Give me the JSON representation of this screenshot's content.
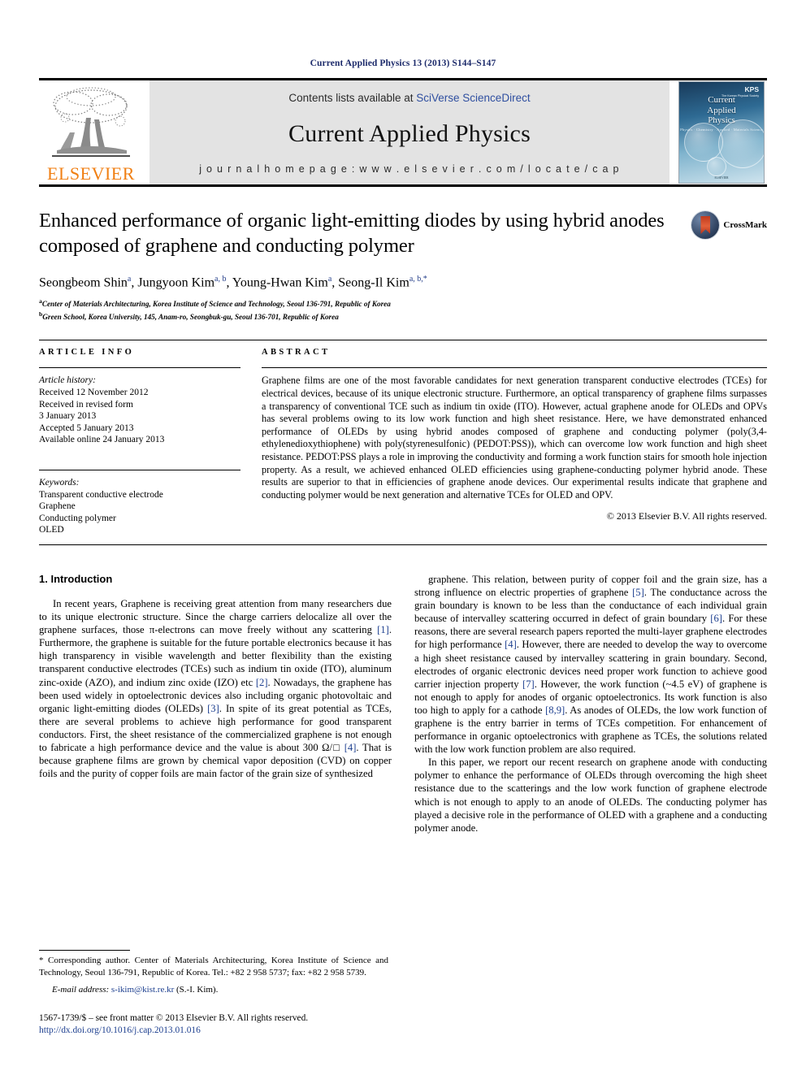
{
  "running_head": "Current Applied Physics 13 (2013) S144–S147",
  "masthead": {
    "publisher_name": "ELSEVIER",
    "contents_prefix": "Contents lists available at ",
    "contents_link": "SciVerse ScienceDirect",
    "journal_title": "Current Applied Physics",
    "homepage_label": "j o u r n a l   h o m e p a g e :   w w w . e l s e v i e r . c o m / l o c a t e / c a p",
    "cover": {
      "line1": "Current",
      "line2": "Applied",
      "line3": "Physics",
      "subtitle": "Physics · Chemistry · Applied · Materials Science",
      "badge": "KPS",
      "badge_sub": "The Korean Physical Society",
      "footer": "ELSEVIER"
    }
  },
  "article": {
    "title": "Enhanced performance of organic light-emitting diodes by using hybrid anodes composed of graphene and conducting polymer",
    "crossmark_label": "CrossMark",
    "authors_html": "Seongbeom Shin<sup>a</sup>, Jungyoon Kim<sup>a, b</sup>, Young-Hwan Kim<sup>a</sup>, Seong-Il Kim<sup>a, b,</sup><sup>*</sup>",
    "affiliations": [
      "Center of Materials Architecturing, Korea Institute of Science and Technology, Seoul 136-791, Republic of Korea",
      "Green School, Korea University, 145, Anam-ro, Seongbuk-gu, Seoul 136-701, Republic of Korea"
    ],
    "affiliation_marks": [
      "a",
      "b"
    ]
  },
  "info": {
    "heading": "ARTICLE INFO",
    "history_label": "Article history:",
    "history": [
      "Received 12 November 2012",
      "Received in revised form",
      "3 January 2013",
      "Accepted 5 January 2013",
      "Available online 24 January 2013"
    ],
    "keywords_label": "Keywords:",
    "keywords": [
      "Transparent conductive electrode",
      "Graphene",
      "Conducting polymer",
      "OLED"
    ]
  },
  "abstract": {
    "heading": "ABSTRACT",
    "text": "Graphene films are one of the most favorable candidates for next generation transparent conductive electrodes (TCEs) for electrical devices, because of its unique electronic structure. Furthermore, an optical transparency of graphene films surpasses a transparency of conventional TCE such as indium tin oxide (ITO). However, actual graphene anode for OLEDs and OPVs has several problems owing to its low work function and high sheet resistance. Here, we have demonstrated enhanced performance of OLEDs by using hybrid anodes composed of graphene and conducting polymer (poly(3,4-ethylenedioxythiophene) with poly(styrenesulfonic) (PEDOT:PSS)), which can overcome low work function and high sheet resistance. PEDOT:PSS plays a role in improving the conductivity and forming a work function stairs for smooth hole injection property. As a result, we achieved enhanced OLED efficiencies using graphene-conducting polymer hybrid anode. These results are superior to that in efficiencies of graphene anode devices. Our experimental results indicate that graphene and conducting polymer would be next generation and alternative TCEs for OLED and OPV.",
    "copyright": "© 2013 Elsevier B.V. All rights reserved."
  },
  "body": {
    "section_title": "1. Introduction",
    "left_paragraph_1_html": "In recent years, Graphene is receiving great attention from many researchers due to its unique electronic structure. Since the charge carriers delocalize all over the graphene surfaces, those &pi;-electrons can move freely without any scattering <span class=\"ref\">[1]</span>. Furthermore, the graphene is suitable for the future portable electronics because it has high transparency in visible wavelength and better flexibility than the existing transparent conductive electrodes (TCEs) such as indium tin oxide (ITO), aluminum zinc-oxide (AZO), and indium zinc oxide (IZO) etc <span class=\"ref\">[2]</span>. Nowadays, the graphene has been used widely in optoelectronic devices also including organic photovoltaic and organic light-emitting diodes (OLEDs) <span class=\"ref\">[3]</span>. In spite of its great potential as TCEs, there are several problems to achieve high performance for good transparent conductors. First, the sheet resistance of the commercialized graphene is not enough to fabricate a high performance device and the value is about 300 &Omega;/&#9633; <span class=\"ref\">[4]</span>. That is because graphene films are grown by chemical vapor deposition (CVD) on copper foils and the purity of copper foils are main factor of the grain size of synthesized",
    "right_paragraph_1_html": "graphene. This relation, between purity of copper foil and the grain size, has a strong influence on electric properties of graphene <span class=\"ref\">[5]</span>. The conductance across the grain boundary is known to be less than the conductance of each individual grain because of intervalley scattering occurred in defect of grain boundary <span class=\"ref\">[6]</span>. For these reasons, there are several research papers reported the multi-layer graphene electrodes for high performance <span class=\"ref\">[4]</span>. However, there are needed to develop the way to overcome a high sheet resistance caused by intervalley scattering in grain boundary. Second, electrodes of organic electronic devices need proper work function to achieve good carrier injection property <span class=\"ref\">[7]</span>. However, the work function (&#126;4.5 eV) of graphene is not enough to apply for anodes of organic optoelectronics. Its work function is also too high to apply for a cathode <span class=\"ref\">[8,9]</span>. As anodes of OLEDs, the low work function of graphene is the entry barrier in terms of TCEs competition. For enhancement of performance in organic optoelectronics with graphene as TCEs, the solutions related with the low work function problem are also required.",
    "right_paragraph_2_html": "In this paper, we report our recent research on graphene anode with conducting polymer to enhance the performance of OLEDs through overcoming the high sheet resistance due to the scatterings and the low work function of graphene electrode which is not enough to apply to an anode of OLEDs. The conducting polymer has played a decisive role in the performance of OLED with a graphene and a conducting polymer anode."
  },
  "footnote": {
    "corresponding_html": "* Corresponding author. Center of Materials Architecturing, Korea Institute of Science and Technology, Seoul 136-791, Republic of Korea. Tel.: +82 2 958 5737; fax: +82 2 958 5739.",
    "email_label": "E-mail address:",
    "email": "s-ikim@kist.re.kr",
    "email_owner": "(S.-I. Kim).",
    "issn_line": "1567-1739/$ – see front matter © 2013 Elsevier B.V. All rights reserved.",
    "doi": "http://dx.doi.org/10.1016/j.cap.2013.01.016"
  },
  "colors": {
    "running_head": "#1d2b6b",
    "elsevier_orange": "#F07F13",
    "link_blue": "#1d3f8f",
    "panel_gray": "#e3e3e3"
  }
}
